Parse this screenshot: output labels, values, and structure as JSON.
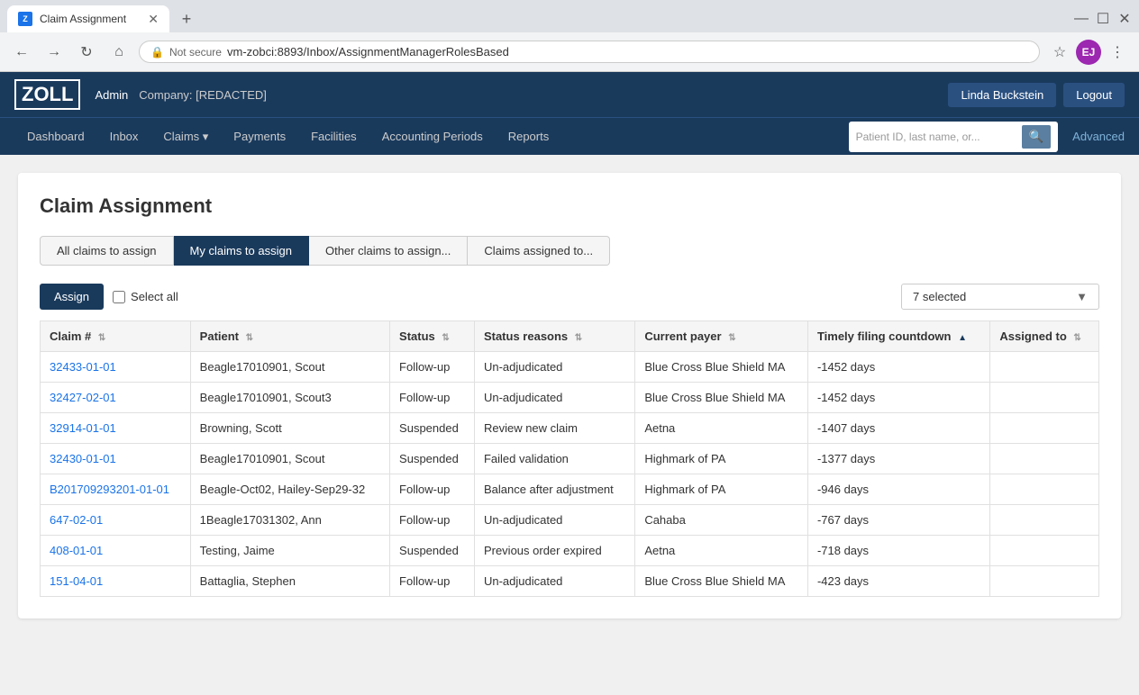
{
  "browser": {
    "tab_title": "Claim Assignment",
    "favicon_text": "Z",
    "not_secure_text": "Not secure",
    "url": "vm-zobci:8893/Inbox/AssignmentManagerRolesBased",
    "new_tab_icon": "+",
    "back_icon": "←",
    "forward_icon": "→",
    "refresh_icon": "↻",
    "home_icon": "⌂",
    "star_icon": "☆",
    "user_avatar": "EJ",
    "more_icon": "⋮"
  },
  "header": {
    "logo": "ZOLL",
    "admin_label": "Admin",
    "company_label": "Company: [REDACTED]",
    "user_name": "Linda Buckstein",
    "logout_label": "Logout"
  },
  "nav": {
    "items": [
      {
        "label": "Dashboard"
      },
      {
        "label": "Inbox"
      },
      {
        "label": "Claims ▾"
      },
      {
        "label": "Payments"
      },
      {
        "label": "Facilities"
      },
      {
        "label": "Accounting Periods"
      },
      {
        "label": "Reports"
      }
    ],
    "search_placeholder": "Patient ID, last name, or...",
    "advanced_label": "Advanced"
  },
  "page": {
    "title": "Claim Assignment",
    "tabs": [
      {
        "label": "All claims to assign",
        "active": false
      },
      {
        "label": "My claims to assign",
        "active": true
      },
      {
        "label": "Other claims to assign...",
        "active": false
      },
      {
        "label": "Claims assigned to...",
        "active": false
      }
    ],
    "selected_text": "7 selected",
    "assign_label": "Assign",
    "select_all_label": "Select all"
  },
  "table": {
    "columns": [
      {
        "label": "Claim #",
        "sortable": true
      },
      {
        "label": "Patient",
        "sortable": true
      },
      {
        "label": "Status",
        "sortable": true
      },
      {
        "label": "Status reasons",
        "sortable": true
      },
      {
        "label": "Current payer",
        "sortable": true
      },
      {
        "label": "Timely filing countdown",
        "sortable": true,
        "sort_active": true
      },
      {
        "label": "Assigned to",
        "sortable": true
      }
    ],
    "rows": [
      {
        "claim_num": "32433-01-01",
        "patient": "Beagle17010901, Scout",
        "status": "Follow-up",
        "status_reason": "Un-adjudicated",
        "payer": "Blue Cross Blue Shield MA",
        "timely": "-1452 days",
        "assigned_to": ""
      },
      {
        "claim_num": "32427-02-01",
        "patient": "Beagle17010901, Scout3",
        "status": "Follow-up",
        "status_reason": "Un-adjudicated",
        "payer": "Blue Cross Blue Shield MA",
        "timely": "-1452 days",
        "assigned_to": ""
      },
      {
        "claim_num": "32914-01-01",
        "patient": "Browning, Scott",
        "status": "Suspended",
        "status_reason": "Review new claim",
        "payer": "Aetna",
        "timely": "-1407 days",
        "assigned_to": ""
      },
      {
        "claim_num": "32430-01-01",
        "patient": "Beagle17010901, Scout",
        "status": "Suspended",
        "status_reason": "Failed validation",
        "payer": "Highmark of PA",
        "timely": "-1377 days",
        "assigned_to": ""
      },
      {
        "claim_num": "B201709293201-01-01",
        "patient": "Beagle-Oct02, Hailey-Sep29-32",
        "status": "Follow-up",
        "status_reason": "Balance after adjustment",
        "payer": "Highmark of PA",
        "timely": "-946 days",
        "assigned_to": ""
      },
      {
        "claim_num": "647-02-01",
        "patient": "1Beagle17031302, Ann",
        "status": "Follow-up",
        "status_reason": "Un-adjudicated",
        "payer": "Cahaba",
        "timely": "-767 days",
        "assigned_to": ""
      },
      {
        "claim_num": "408-01-01",
        "patient": "Testing, Jaime",
        "status": "Suspended",
        "status_reason": "Previous order expired",
        "payer": "Aetna",
        "timely": "-718 days",
        "assigned_to": ""
      },
      {
        "claim_num": "151-04-01",
        "patient": "Battaglia, Stephen",
        "status": "Follow-up",
        "status_reason": "Un-adjudicated",
        "payer": "Blue Cross Blue Shield MA",
        "timely": "-423 days",
        "assigned_to": ""
      }
    ]
  }
}
